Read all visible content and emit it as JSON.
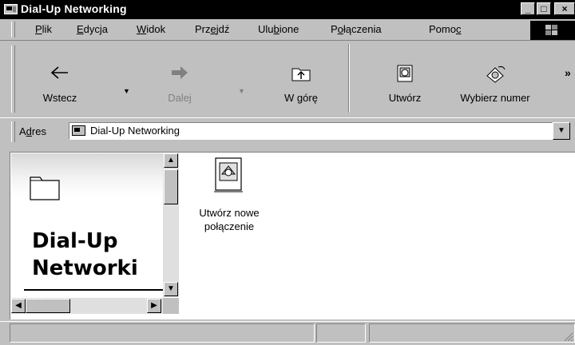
{
  "window": {
    "title": "Dial-Up Networking",
    "controls": {
      "minimize": "_",
      "maximize": "□",
      "close": "×"
    }
  },
  "menu": {
    "items": [
      {
        "pre": "",
        "ul": "P",
        "post": "lik"
      },
      {
        "pre": "",
        "ul": "E",
        "post": "dycja"
      },
      {
        "pre": "",
        "ul": "W",
        "post": "idok"
      },
      {
        "pre": "Prz",
        "ul": "e",
        "post": "jdź"
      },
      {
        "pre": "Ulu",
        "ul": "b",
        "post": "ione"
      },
      {
        "pre": "P",
        "ul": "o",
        "post": "łączenia"
      },
      {
        "pre": "Pomo",
        "ul": "c",
        "post": ""
      }
    ]
  },
  "toolbar": {
    "back": "Wstecz",
    "forward": "Dalej",
    "up": "W górę",
    "create": "Utwórz",
    "dial": "Wybierz numer",
    "more": "»"
  },
  "address": {
    "label_pre": "A",
    "label_ul": "d",
    "label_post": "res",
    "value": "Dial-Up Networking"
  },
  "panel": {
    "title_line1": "Dial-Up",
    "title_line2": "Networki"
  },
  "content": {
    "items": [
      {
        "label_line1": "Utwórz nowe",
        "label_line2": "połączenie",
        "icon": "new-connection-icon"
      }
    ]
  }
}
